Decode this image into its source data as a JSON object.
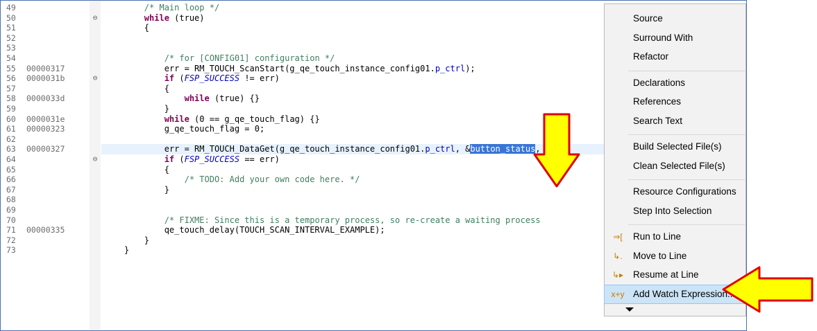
{
  "editor": {
    "lines": [
      {
        "ln": "49",
        "addr": "",
        "fold": "",
        "segs": [
          {
            "t": "        "
          },
          {
            "t": "/* Main loop */",
            "c": "cm"
          }
        ]
      },
      {
        "ln": "50",
        "addr": "",
        "fold": "⊖",
        "segs": [
          {
            "t": "        "
          },
          {
            "t": "while",
            "c": "kw"
          },
          {
            "t": " (true)"
          }
        ]
      },
      {
        "ln": "51",
        "addr": "",
        "fold": "",
        "segs": [
          {
            "t": "        {"
          }
        ]
      },
      {
        "ln": "52",
        "addr": "",
        "fold": "",
        "segs": []
      },
      {
        "ln": "53",
        "addr": "",
        "fold": "",
        "segs": []
      },
      {
        "ln": "54",
        "addr": "",
        "fold": "",
        "segs": [
          {
            "t": "            "
          },
          {
            "t": "/* for [CONFIG01] configuration */",
            "c": "cm"
          }
        ]
      },
      {
        "ln": "55",
        "addr": "00000317",
        "fold": "",
        "segs": [
          {
            "t": "            err = RM_TOUCH_ScanStart(g_qe_touch_instance_config01."
          },
          {
            "t": "p_ctrl",
            "c": "fld"
          },
          {
            "t": ");"
          }
        ]
      },
      {
        "ln": "56",
        "addr": "0000031b",
        "fold": "⊖",
        "segs": [
          {
            "t": "            "
          },
          {
            "t": "if",
            "c": "kw"
          },
          {
            "t": " ("
          },
          {
            "t": "FSP_SUCCESS",
            "c": "it"
          },
          {
            "t": " != err)"
          }
        ]
      },
      {
        "ln": "57",
        "addr": "",
        "fold": "",
        "segs": [
          {
            "t": "            {"
          }
        ]
      },
      {
        "ln": "58",
        "addr": "0000033d",
        "fold": "",
        "segs": [
          {
            "t": "                "
          },
          {
            "t": "while",
            "c": "kw"
          },
          {
            "t": " (true) {}"
          }
        ]
      },
      {
        "ln": "59",
        "addr": "",
        "fold": "",
        "segs": [
          {
            "t": "            }"
          }
        ]
      },
      {
        "ln": "60",
        "addr": "0000031e",
        "fold": "",
        "segs": [
          {
            "t": "            "
          },
          {
            "t": "while",
            "c": "kw"
          },
          {
            "t": " (0 == g_qe_touch_flag) {}"
          }
        ]
      },
      {
        "ln": "61",
        "addr": "00000323",
        "fold": "",
        "segs": [
          {
            "t": "            g_qe_touch_flag = 0;"
          }
        ]
      },
      {
        "ln": "62",
        "addr": "",
        "fold": "",
        "segs": []
      },
      {
        "ln": "63",
        "addr": "00000327",
        "fold": "",
        "hl": true,
        "segs": [
          {
            "t": "            err = RM_TOUCH_DataGet(g_qe_touch_instance_config01."
          },
          {
            "t": "p_ctrl",
            "c": "fld"
          },
          {
            "t": ", &"
          },
          {
            "t": "button_status",
            "c": "sel"
          },
          {
            "t": ","
          }
        ]
      },
      {
        "ln": "64",
        "addr": "",
        "fold": "⊖",
        "segs": [
          {
            "t": "            "
          },
          {
            "t": "if",
            "c": "kw"
          },
          {
            "t": " ("
          },
          {
            "t": "FSP_SUCCESS",
            "c": "it"
          },
          {
            "t": " == err)"
          }
        ]
      },
      {
        "ln": "65",
        "addr": "",
        "fold": "",
        "segs": [
          {
            "t": "            {"
          }
        ]
      },
      {
        "ln": "66",
        "addr": "",
        "fold": "",
        "segs": [
          {
            "t": "                "
          },
          {
            "t": "/* TODO: Add your own code here. */",
            "c": "cm"
          }
        ]
      },
      {
        "ln": "67",
        "addr": "",
        "fold": "",
        "segs": [
          {
            "t": "            }"
          }
        ]
      },
      {
        "ln": "68",
        "addr": "",
        "fold": "",
        "segs": []
      },
      {
        "ln": "69",
        "addr": "",
        "fold": "",
        "segs": []
      },
      {
        "ln": "70",
        "addr": "",
        "fold": "",
        "segs": [
          {
            "t": "            "
          },
          {
            "t": "/* FIXME: Since this is a temporary process, so re-create a waiting process",
            "c": "cm"
          }
        ]
      },
      {
        "ln": "71",
        "addr": "00000335",
        "fold": "",
        "segs": [
          {
            "t": "            qe_touch_delay(TOUCH_SCAN_INTERVAL_EXAMPLE);"
          }
        ]
      },
      {
        "ln": "72",
        "addr": "",
        "fold": "",
        "segs": [
          {
            "t": "        }"
          }
        ]
      },
      {
        "ln": "73",
        "addr": "",
        "fold": "",
        "segs": [
          {
            "t": "    }"
          }
        ]
      }
    ]
  },
  "context_menu": {
    "items": [
      {
        "label": "Source",
        "icon": ""
      },
      {
        "label": "Surround With",
        "icon": ""
      },
      {
        "label": "Refactor",
        "icon": ""
      },
      {
        "sep": true
      },
      {
        "label": "Declarations",
        "icon": ""
      },
      {
        "label": "References",
        "icon": ""
      },
      {
        "label": "Search Text",
        "icon": ""
      },
      {
        "sep": true
      },
      {
        "label": "Build Selected File(s)",
        "icon": ""
      },
      {
        "label": "Clean Selected File(s)",
        "icon": ""
      },
      {
        "sep": true
      },
      {
        "label": "Resource Configurations",
        "icon": ""
      },
      {
        "label": "Step Into Selection",
        "icon": ""
      },
      {
        "sep": true
      },
      {
        "label": "Run to Line",
        "icon": "run-to-line-icon",
        "glyph": "⇒["
      },
      {
        "label": "Move to Line",
        "icon": "move-to-line-icon",
        "glyph": "↳."
      },
      {
        "label": "Resume at Line",
        "icon": "resume-at-line-icon",
        "glyph": "↳▸"
      },
      {
        "label": "Add Watch Expression...",
        "icon": "watch-expression-icon",
        "glyph": "x+y",
        "active": true
      }
    ],
    "more_icon": "chevron-down-icon"
  },
  "annotation": {
    "arrow_color": "#ffff00",
    "arrow_stroke": "#e00000"
  }
}
